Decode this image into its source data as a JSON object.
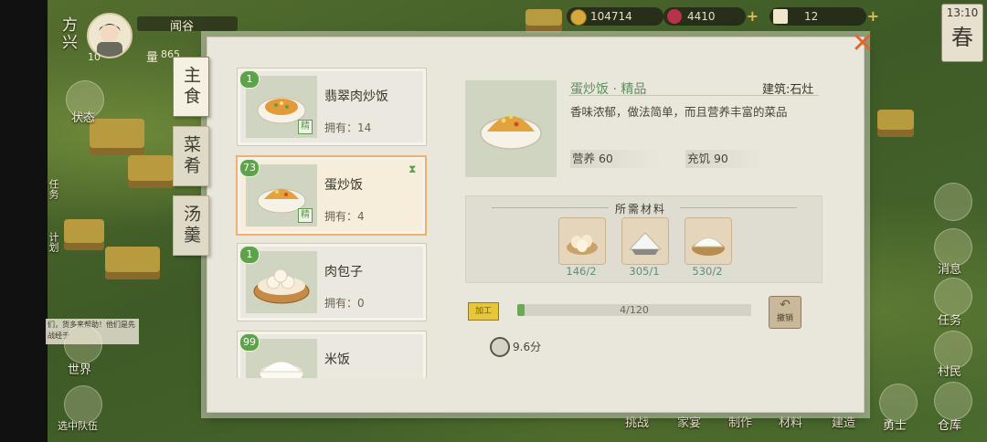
{
  "hud": {
    "side_label": "方兴",
    "player_name": "闻谷",
    "level": "10",
    "partial_label": "量",
    "partial_value": "865",
    "coins": "104714",
    "gems": "4410",
    "tickets": "12",
    "clock": "13:10",
    "season": "春"
  },
  "left_menu": {
    "status": "状态",
    "task": "任务",
    "plan": "计划",
    "world": "世界",
    "team": "选中队伍",
    "notice": "们，货多来帮助！他们是先战经于"
  },
  "right_menu": {
    "digest": "消息",
    "task": "任务",
    "villagers": "村民",
    "warrior": "勇士",
    "storage": "仓库"
  },
  "bottom_bar": [
    "挑战",
    "家宴",
    "制作",
    "材料",
    "建造"
  ],
  "tabs": [
    "主食",
    "菜肴",
    "汤羹"
  ],
  "recipes": [
    {
      "badge": "1",
      "name": "翡翠肉炒饭",
      "owned": "拥有：14",
      "quality": "精",
      "selected": false
    },
    {
      "badge": "73",
      "name": "蛋炒饭",
      "owned": "拥有：4",
      "quality": "精",
      "selected": true
    },
    {
      "badge": "1",
      "name": "肉包子",
      "owned": "拥有：0",
      "quality": "",
      "selected": false
    },
    {
      "badge": "99",
      "name": "米饭",
      "owned": "",
      "quality": "",
      "selected": false
    }
  ],
  "detail": {
    "title": "蛋炒饭 · 精品",
    "location": "建筑:石灶",
    "description": "香味浓郁，做法简单，而且营养丰富的菜品",
    "nutrition": "营养 60",
    "satiety": "充饥 90",
    "materials_title": "所需材料",
    "materials": [
      {
        "icon": "eggs-icon",
        "count": "146/2"
      },
      {
        "icon": "salt-icon",
        "count": "305/1"
      },
      {
        "icon": "rice-icon",
        "count": "530/2"
      }
    ],
    "cook_label": "加工",
    "progress_text": "4/120",
    "progress": 0.033,
    "cancel_label": "撤销",
    "time": "9.6分"
  }
}
